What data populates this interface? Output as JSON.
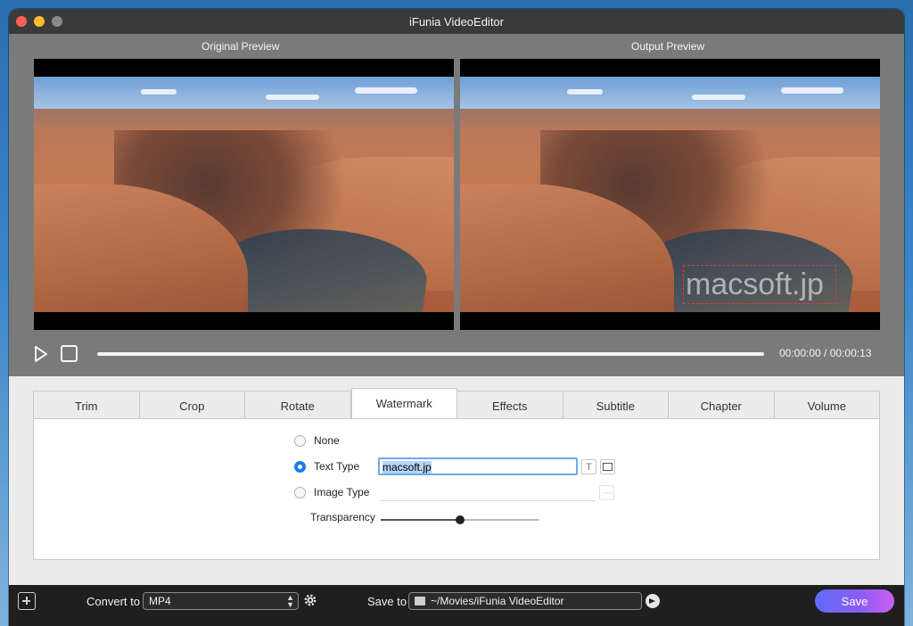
{
  "window": {
    "title": "iFunia VideoEditor"
  },
  "preview": {
    "original_label": "Original Preview",
    "output_label": "Output Preview",
    "watermark_text": "macsoft.jp",
    "time_display": "00:00:00 / 00:00:13",
    "seek_progress": 0
  },
  "tabs": [
    {
      "label": "Trim"
    },
    {
      "label": "Crop"
    },
    {
      "label": "Rotate"
    },
    {
      "label": "Watermark"
    },
    {
      "label": "Effects"
    },
    {
      "label": "Subtitle"
    },
    {
      "label": "Chapter"
    },
    {
      "label": "Volume"
    }
  ],
  "active_tab": "Watermark",
  "watermark_panel": {
    "none_label": "None",
    "text_type_label": "Text Type",
    "text_value": "macsoft.jp",
    "image_type_label": "Image Type",
    "transparency_label": "Transparency",
    "transparency_value": 0.5,
    "selected_option": "Text Type"
  },
  "bottom": {
    "convert_label": "Convert to",
    "format_value": "MP4",
    "save_to_label": "Save to",
    "save_path": "~/Movies/iFunia VideoEditor",
    "save_button": "Save"
  },
  "colors": {
    "accent": "#1a7cf2",
    "watermark_border": "#e03a3a",
    "save_gradient_start": "#5f6df6",
    "save_gradient_end": "#c95ef0"
  }
}
